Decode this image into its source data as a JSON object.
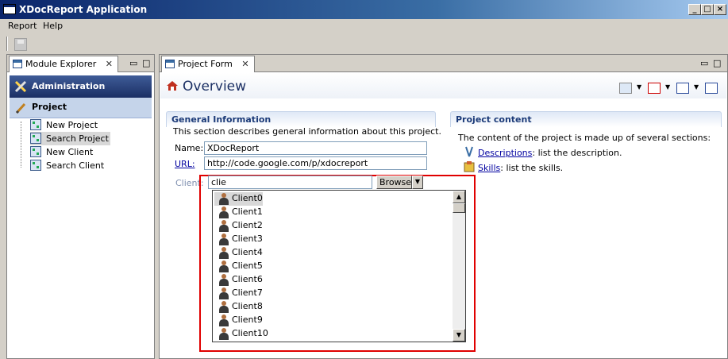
{
  "window": {
    "title": "XDocReport Application"
  },
  "menu": {
    "report": "Report",
    "help": "Help"
  },
  "explorer": {
    "tab_label": "Module Explorer",
    "administration": "Administration",
    "project": "Project",
    "items": [
      {
        "label": "New Project"
      },
      {
        "label": "Search Project"
      },
      {
        "label": "New Client"
      },
      {
        "label": "Search Client"
      }
    ]
  },
  "form": {
    "tab_label": "Project Form",
    "overview_title": "Overview",
    "general": {
      "title": "General Information",
      "description": "This section describes general information about this project.",
      "name_label": "Name:",
      "name_value": "XDocReport",
      "url_label": "URL:",
      "url_value": "http://code.google.com/p/xdocreport",
      "client_label": "Client:",
      "client_value": "clie",
      "browse_label": "Browse"
    },
    "content": {
      "title": "Project content",
      "description": "The content of the project is made up of several sections:",
      "descriptions_link": "Descriptions",
      "descriptions_text": ": list the description.",
      "skills_link": "Skills",
      "skills_text": ": list the skills."
    }
  },
  "client_list": {
    "items": [
      "Client0",
      "Client1",
      "Client2",
      "Client3",
      "Client4",
      "Client5",
      "Client6",
      "Client7",
      "Client8",
      "Client9",
      "Client10"
    ],
    "selected": "Client0"
  }
}
